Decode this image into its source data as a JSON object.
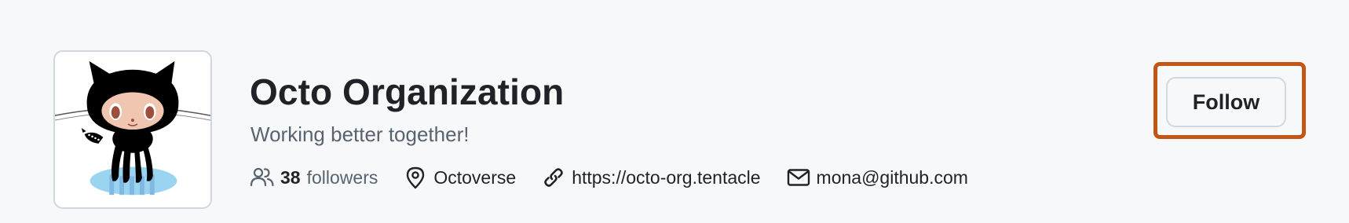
{
  "org": {
    "name": "Octo Organization",
    "description": "Working better together!"
  },
  "meta": {
    "followers_count": "38",
    "followers_label": "followers",
    "location": "Octoverse",
    "website": "https://octo-org.tentacle",
    "email": "mona@github.com"
  },
  "actions": {
    "follow_label": "Follow"
  },
  "icons": {
    "followers": "people-icon",
    "location": "location-pin-icon",
    "website": "link-icon",
    "email": "mail-icon"
  },
  "colors": {
    "background": "#f6f8fa",
    "text_primary": "#1f2328",
    "text_muted": "#59636e",
    "border": "#d0d7de",
    "highlight": "#c35515"
  }
}
